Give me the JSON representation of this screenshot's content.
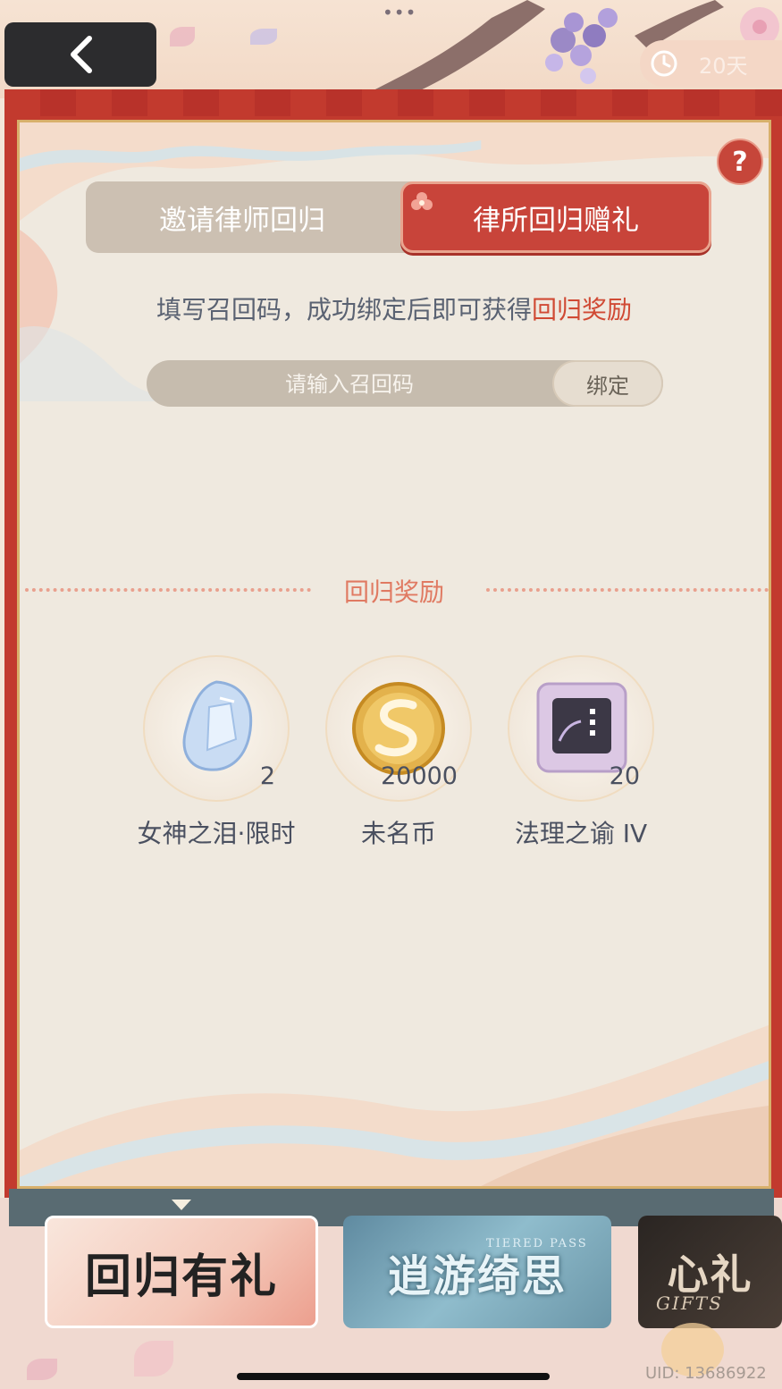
{
  "header": {
    "more_dots": "•••",
    "timer_text": "20天"
  },
  "tabs": [
    {
      "label": "邀请律师回归",
      "active": false
    },
    {
      "label": "律所回归赠礼",
      "active": true
    }
  ],
  "instruction": {
    "text": "填写召回码，成功绑定后即可获得",
    "highlight": "回归奖励"
  },
  "code_input": {
    "placeholder": "请输入召回码",
    "value": ""
  },
  "bind_button": "绑定",
  "rewards_section": {
    "title": "回归奖励",
    "items": [
      {
        "name": "女神之泪·限时",
        "count": "2",
        "icon": "teardrop-crystal-icon"
      },
      {
        "name": "未名币",
        "count": "20000",
        "icon": "gold-coin-icon"
      },
      {
        "name": "法理之谕 IV",
        "count": "20",
        "icon": "card-chip-icon"
      }
    ]
  },
  "banners": [
    {
      "title": "回归有礼",
      "sub": ""
    },
    {
      "title": "逍游绮思",
      "sub": "TIERED PASS"
    },
    {
      "title": "心礼",
      "sub": "GIFTS"
    }
  ],
  "uid": "UID: 13686922",
  "colors": {
    "accent": "#c8443a",
    "highlight_text": "#d04a34",
    "panel_bg": "#efe9df",
    "tab_inactive": "#ccc0b2"
  }
}
